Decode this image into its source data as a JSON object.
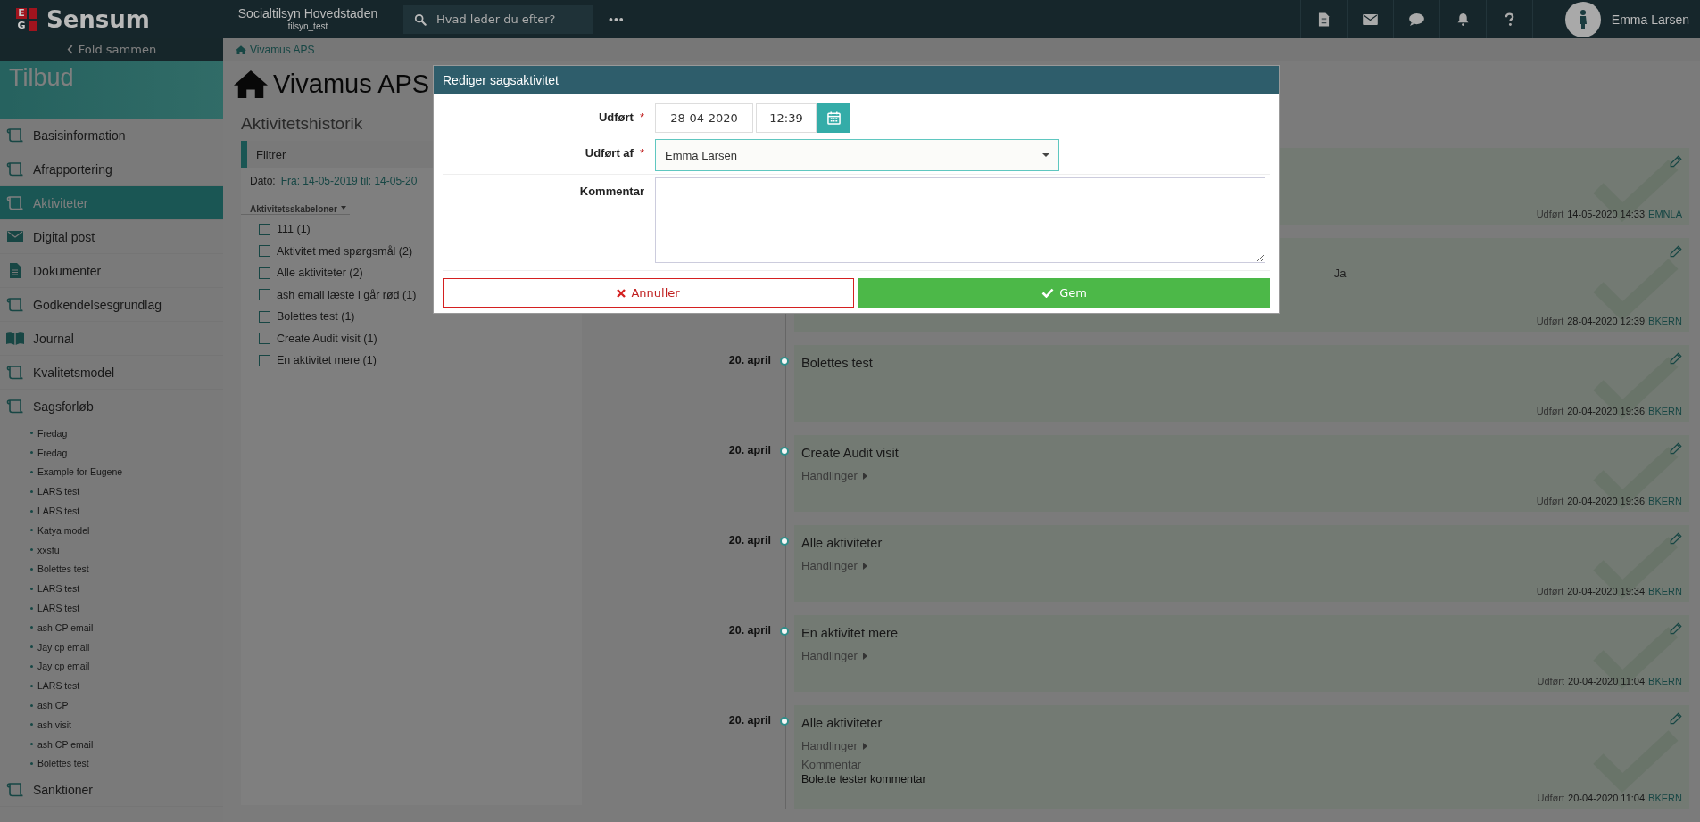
{
  "topbar": {
    "logo": {
      "letters": [
        "E",
        "G"
      ],
      "name": "Sensum"
    },
    "organisation": "Socialtilsyn Hovedstaden",
    "subtitle": "tilsyn_test",
    "search": {
      "placeholder": "Hvad leder du efter?"
    },
    "more": "•••",
    "icons": [
      {
        "kind": "document"
      },
      {
        "kind": "mail"
      },
      {
        "kind": "chat"
      },
      {
        "kind": "bell"
      },
      {
        "kind": "help"
      }
    ],
    "user": "Emma Larsen"
  },
  "sidebar": {
    "collapse": "Fold sammen",
    "title": "Tilbud",
    "items": [
      {
        "label": "Basisinformation",
        "kind": "scroll",
        "selected": false
      },
      {
        "label": "Afrapportering",
        "kind": "scroll",
        "selected": false
      },
      {
        "label": "Aktiviteter",
        "kind": "scroll",
        "selected": true
      },
      {
        "label": "Digital post",
        "kind": "mail",
        "selected": false
      },
      {
        "label": "Dokumenter",
        "kind": "document",
        "selected": false
      },
      {
        "label": "Godkendelsesgrundlag",
        "kind": "scroll",
        "selected": false
      },
      {
        "label": "Journal",
        "kind": "book",
        "selected": false
      },
      {
        "label": "Kvalitetsmodel",
        "kind": "scroll",
        "selected": false
      },
      {
        "label": "Sagsforløb",
        "kind": "scroll",
        "selected": false,
        "children": [
          "Fredag",
          "Fredag",
          "Example for Eugene",
          "LARS test",
          "LARS test",
          "Katya model",
          "xxsfu",
          "Bolettes test",
          "LARS test",
          "LARS test",
          "ash CP email",
          "Jay cp email",
          "Jay cp email",
          "LARS test",
          "ash CP",
          "ash visit",
          "ash CP email",
          "Bolettes test"
        ]
      },
      {
        "label": "Sanktioner",
        "kind": "scroll",
        "selected": false
      }
    ]
  },
  "breadcrumb": "Vivamus APS",
  "page_title": "Vivamus APS",
  "section_title": "Aktivitetshistorik",
  "filter": {
    "title": "Filtrer",
    "date_label": "Dato:",
    "date_value": "Fra: 14-05-2019 til: 14-05-20",
    "templates_header": "Aktivitetsskabeloner",
    "templates": [
      {
        "label": "111 (1)",
        "checked": false
      },
      {
        "label": "Aktivitet med spørgsmål (2)",
        "checked": false
      },
      {
        "label": "Alle aktiviteter (2)",
        "checked": false
      },
      {
        "label": "ash email læste i går rød (1)",
        "checked": false
      },
      {
        "label": "Bolettes test (1)",
        "checked": false
      },
      {
        "label": "Create Audit visit (1)",
        "checked": false
      },
      {
        "label": "En aktivitet mere (1)",
        "checked": false
      }
    ]
  },
  "timeline": [
    {
      "done_label": "Udført",
      "done_at": "14-05-2020 14:33",
      "user": "EMNLA"
    },
    {
      "answer": "Ja",
      "done_label": "Udført",
      "done_at": "28-04-2020 12:39",
      "user": "BKERN"
    },
    {
      "date": "20. april",
      "title": "Bolettes test",
      "done_label": "Udført",
      "done_at": "20-04-2020 19:36",
      "user": "BKERN"
    },
    {
      "date": "20. april",
      "title": "Create Audit visit",
      "actions": "Handlinger",
      "done_label": "Udført",
      "done_at": "20-04-2020 19:36",
      "user": "BKERN"
    },
    {
      "date": "20. april",
      "title": "Alle aktiviteter",
      "actions": "Handlinger",
      "done_label": "Udført",
      "done_at": "20-04-2020 19:34",
      "user": "BKERN"
    },
    {
      "date": "20. april",
      "title": "En aktivitet mere",
      "actions": "Handlinger",
      "done_label": "Udført",
      "done_at": "20-04-2020 11:04",
      "user": "BKERN"
    },
    {
      "date": "20. april",
      "title": "Alle aktiviteter",
      "actions": "Handlinger",
      "comment_label": "Kommentar",
      "comment": "Bolette tester kommentar",
      "done_label": "Udført",
      "done_at": "20-04-2020 11:04",
      "user": "BKERN"
    }
  ],
  "modal": {
    "title": "Rediger sagsaktivitet",
    "fields": [
      {
        "kind": "datetime",
        "label": "Udført",
        "required": true,
        "date": "28-04-2020",
        "time": "12:39"
      },
      {
        "kind": "select",
        "label": "Udført af",
        "required": true,
        "value": "Emma Larsen"
      },
      {
        "kind": "textarea",
        "label": "Kommentar",
        "required": false
      }
    ],
    "required_mark": "*",
    "cancel": "Annuller",
    "save": "Gem"
  }
}
